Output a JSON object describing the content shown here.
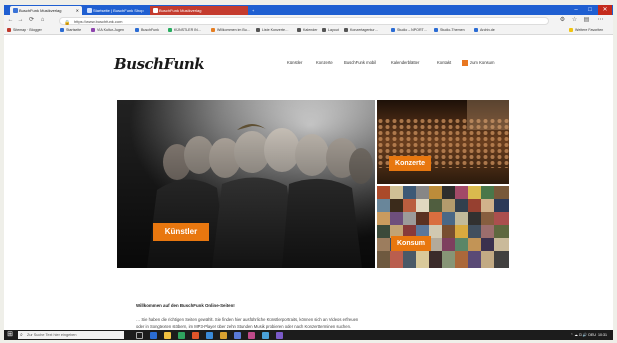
{
  "browser": {
    "tabs": [
      {
        "label": "BuschFunk Musikverlag",
        "active": true
      },
      {
        "label": "Startseite | BuschFunk Shop",
        "active": false
      },
      {
        "label": "BuschFunk Musikverlag",
        "active": false
      }
    ],
    "new_tab_label": "+",
    "window": {
      "minimize": "–",
      "maximize": "□",
      "close": "✕"
    },
    "address": "https://www.buschfunk.com",
    "nav": {
      "back": "←",
      "forward": "→",
      "reload": "⟳",
      "home": "⌂"
    },
    "bookmarks": [
      {
        "label": "Sitemap · Blogger",
        "color": "#c0392b"
      },
      {
        "label": "Startseite",
        "color": "#2b6cd4"
      },
      {
        "label": "VIA Kultur-Jugen",
        "color": "#8e44ad"
      },
      {
        "label": "BuschFunk",
        "color": "#2b6cd4"
      },
      {
        "label": "KÜNSTLER IN…",
        "color": "#27ae60"
      },
      {
        "label": "Willkommen im Bu…",
        "color": "#e67e22"
      },
      {
        "label": "Liste Konzerte…",
        "color": "#555555"
      },
      {
        "label": "Kalender",
        "color": "#555555"
      },
      {
        "label": "Layout",
        "color": "#555555"
      },
      {
        "label": "Konzertagentur…",
        "color": "#555555"
      },
      {
        "label": "Studio – NPORT…",
        "color": "#2b6cd4"
      },
      {
        "label": "Studio-Themen",
        "color": "#2b6cd4"
      },
      {
        "label": "Archiv.de",
        "color": "#2b6cd4"
      },
      {
        "label": "Weitere Favoriten",
        "color": "#f1c40f"
      }
    ]
  },
  "site": {
    "logo": "BuschFunk",
    "nav": [
      {
        "label": "Künstler"
      },
      {
        "label": "Konzerte"
      },
      {
        "label": "BuschFunk mobil"
      },
      {
        "label": "Kalenderblätter"
      },
      {
        "label": "Kontakt"
      },
      {
        "label": "zum Konsum"
      }
    ],
    "tiles": {
      "artists": "Künstler",
      "concerts": "Konzerte",
      "shop": "Konsum"
    },
    "welcome_title": "Willkommen auf den BuschFunk Online-Seiten!",
    "intro_line1": "… Sie haben die richtigen Seiten gewählt. Sie finden hier ausführliche Künstlerportraits, können sich an Videos erfreuen",
    "intro_line2": "oder in Songtexten stöbern, im MP3-Player über zehn Stunden Musik probieren oder nach Konzertterminen suchen."
  },
  "taskbar": {
    "search_placeholder": "Zur Suche Text hier eingeben",
    "tray_text": "⌃ ☁ ⊡ 🔊 DEU",
    "clock": "10:31"
  },
  "colors": {
    "accent_orange": "#e8770f",
    "tab_strip": "#1f5fd1",
    "taskbar": "#1c1c1c"
  }
}
